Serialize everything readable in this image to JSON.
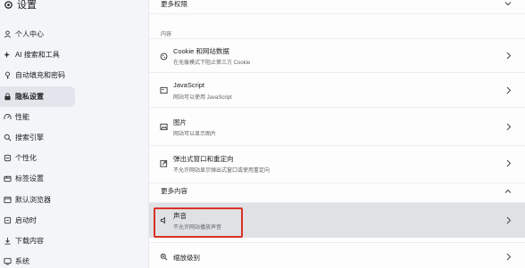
{
  "app": {
    "title": "设置"
  },
  "sidebar": {
    "items": [
      {
        "label": "个人中心",
        "icon": "person-icon"
      },
      {
        "label": "AI 搜索和工具",
        "icon": "ai-sparkle-icon"
      },
      {
        "label": "自动填充和密码",
        "icon": "key-icon"
      },
      {
        "label": "隐私设置",
        "icon": "lock-icon",
        "active": true
      },
      {
        "label": "性能",
        "icon": "gauge-icon"
      },
      {
        "label": "搜索引擎",
        "icon": "search-icon"
      },
      {
        "label": "个性化",
        "icon": "palette-icon"
      },
      {
        "label": "标签设置",
        "icon": "tabs-icon"
      },
      {
        "label": "默认浏览器",
        "icon": "browser-icon"
      },
      {
        "label": "启动时",
        "icon": "power-icon"
      },
      {
        "label": "下载内容",
        "icon": "download-icon"
      },
      {
        "label": "系统",
        "icon": "system-icon"
      }
    ]
  },
  "main": {
    "more_permissions": "更多权限",
    "content_label": "内容",
    "rows": [
      {
        "title": "Cookie 和网站数据",
        "subtitle": "在无痕模式下阻止第三方 Cookie",
        "icon": "cookie-icon"
      },
      {
        "title": "JavaScript",
        "subtitle": "网站可以使用 JavaScript",
        "icon": "code-icon"
      },
      {
        "title": "图片",
        "subtitle": "网站可以显示图片",
        "icon": "image-icon"
      },
      {
        "title": "弹出式窗口和重定向",
        "subtitle": "不允许网站显示弹出式窗口或使用重定向",
        "icon": "popup-icon"
      }
    ],
    "more_content": "更多内容",
    "sound": {
      "title": "声音",
      "subtitle": "不允许网站播放声音",
      "icon": "sound-muted-icon"
    },
    "zoom": {
      "title": "缩放级别",
      "icon": "zoom-icon"
    }
  },
  "colors": {
    "highlight_border": "#d93025",
    "active_nav": "#e2e6ec"
  }
}
